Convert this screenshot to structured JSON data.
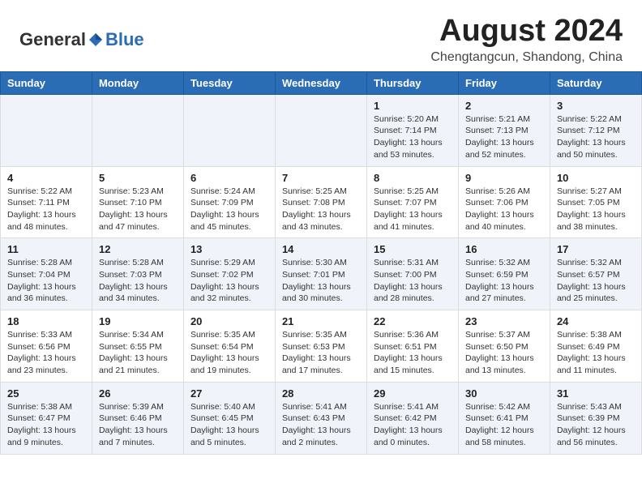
{
  "header": {
    "logo_general": "General",
    "logo_blue": "Blue",
    "main_title": "August 2024",
    "subtitle": "Chengtangcun, Shandong, China"
  },
  "weekdays": [
    "Sunday",
    "Monday",
    "Tuesday",
    "Wednesday",
    "Thursday",
    "Friday",
    "Saturday"
  ],
  "weeks": [
    [
      {
        "day": "",
        "info": ""
      },
      {
        "day": "",
        "info": ""
      },
      {
        "day": "",
        "info": ""
      },
      {
        "day": "",
        "info": ""
      },
      {
        "day": "1",
        "info": "Sunrise: 5:20 AM\nSunset: 7:14 PM\nDaylight: 13 hours\nand 53 minutes."
      },
      {
        "day": "2",
        "info": "Sunrise: 5:21 AM\nSunset: 7:13 PM\nDaylight: 13 hours\nand 52 minutes."
      },
      {
        "day": "3",
        "info": "Sunrise: 5:22 AM\nSunset: 7:12 PM\nDaylight: 13 hours\nand 50 minutes."
      }
    ],
    [
      {
        "day": "4",
        "info": "Sunrise: 5:22 AM\nSunset: 7:11 PM\nDaylight: 13 hours\nand 48 minutes."
      },
      {
        "day": "5",
        "info": "Sunrise: 5:23 AM\nSunset: 7:10 PM\nDaylight: 13 hours\nand 47 minutes."
      },
      {
        "day": "6",
        "info": "Sunrise: 5:24 AM\nSunset: 7:09 PM\nDaylight: 13 hours\nand 45 minutes."
      },
      {
        "day": "7",
        "info": "Sunrise: 5:25 AM\nSunset: 7:08 PM\nDaylight: 13 hours\nand 43 minutes."
      },
      {
        "day": "8",
        "info": "Sunrise: 5:25 AM\nSunset: 7:07 PM\nDaylight: 13 hours\nand 41 minutes."
      },
      {
        "day": "9",
        "info": "Sunrise: 5:26 AM\nSunset: 7:06 PM\nDaylight: 13 hours\nand 40 minutes."
      },
      {
        "day": "10",
        "info": "Sunrise: 5:27 AM\nSunset: 7:05 PM\nDaylight: 13 hours\nand 38 minutes."
      }
    ],
    [
      {
        "day": "11",
        "info": "Sunrise: 5:28 AM\nSunset: 7:04 PM\nDaylight: 13 hours\nand 36 minutes."
      },
      {
        "day": "12",
        "info": "Sunrise: 5:28 AM\nSunset: 7:03 PM\nDaylight: 13 hours\nand 34 minutes."
      },
      {
        "day": "13",
        "info": "Sunrise: 5:29 AM\nSunset: 7:02 PM\nDaylight: 13 hours\nand 32 minutes."
      },
      {
        "day": "14",
        "info": "Sunrise: 5:30 AM\nSunset: 7:01 PM\nDaylight: 13 hours\nand 30 minutes."
      },
      {
        "day": "15",
        "info": "Sunrise: 5:31 AM\nSunset: 7:00 PM\nDaylight: 13 hours\nand 28 minutes."
      },
      {
        "day": "16",
        "info": "Sunrise: 5:32 AM\nSunset: 6:59 PM\nDaylight: 13 hours\nand 27 minutes."
      },
      {
        "day": "17",
        "info": "Sunrise: 5:32 AM\nSunset: 6:57 PM\nDaylight: 13 hours\nand 25 minutes."
      }
    ],
    [
      {
        "day": "18",
        "info": "Sunrise: 5:33 AM\nSunset: 6:56 PM\nDaylight: 13 hours\nand 23 minutes."
      },
      {
        "day": "19",
        "info": "Sunrise: 5:34 AM\nSunset: 6:55 PM\nDaylight: 13 hours\nand 21 minutes."
      },
      {
        "day": "20",
        "info": "Sunrise: 5:35 AM\nSunset: 6:54 PM\nDaylight: 13 hours\nand 19 minutes."
      },
      {
        "day": "21",
        "info": "Sunrise: 5:35 AM\nSunset: 6:53 PM\nDaylight: 13 hours\nand 17 minutes."
      },
      {
        "day": "22",
        "info": "Sunrise: 5:36 AM\nSunset: 6:51 PM\nDaylight: 13 hours\nand 15 minutes."
      },
      {
        "day": "23",
        "info": "Sunrise: 5:37 AM\nSunset: 6:50 PM\nDaylight: 13 hours\nand 13 minutes."
      },
      {
        "day": "24",
        "info": "Sunrise: 5:38 AM\nSunset: 6:49 PM\nDaylight: 13 hours\nand 11 minutes."
      }
    ],
    [
      {
        "day": "25",
        "info": "Sunrise: 5:38 AM\nSunset: 6:47 PM\nDaylight: 13 hours\nand 9 minutes."
      },
      {
        "day": "26",
        "info": "Sunrise: 5:39 AM\nSunset: 6:46 PM\nDaylight: 13 hours\nand 7 minutes."
      },
      {
        "day": "27",
        "info": "Sunrise: 5:40 AM\nSunset: 6:45 PM\nDaylight: 13 hours\nand 5 minutes."
      },
      {
        "day": "28",
        "info": "Sunrise: 5:41 AM\nSunset: 6:43 PM\nDaylight: 13 hours\nand 2 minutes."
      },
      {
        "day": "29",
        "info": "Sunrise: 5:41 AM\nSunset: 6:42 PM\nDaylight: 13 hours\nand 0 minutes."
      },
      {
        "day": "30",
        "info": "Sunrise: 5:42 AM\nSunset: 6:41 PM\nDaylight: 12 hours\nand 58 minutes."
      },
      {
        "day": "31",
        "info": "Sunrise: 5:43 AM\nSunset: 6:39 PM\nDaylight: 12 hours\nand 56 minutes."
      }
    ]
  ]
}
